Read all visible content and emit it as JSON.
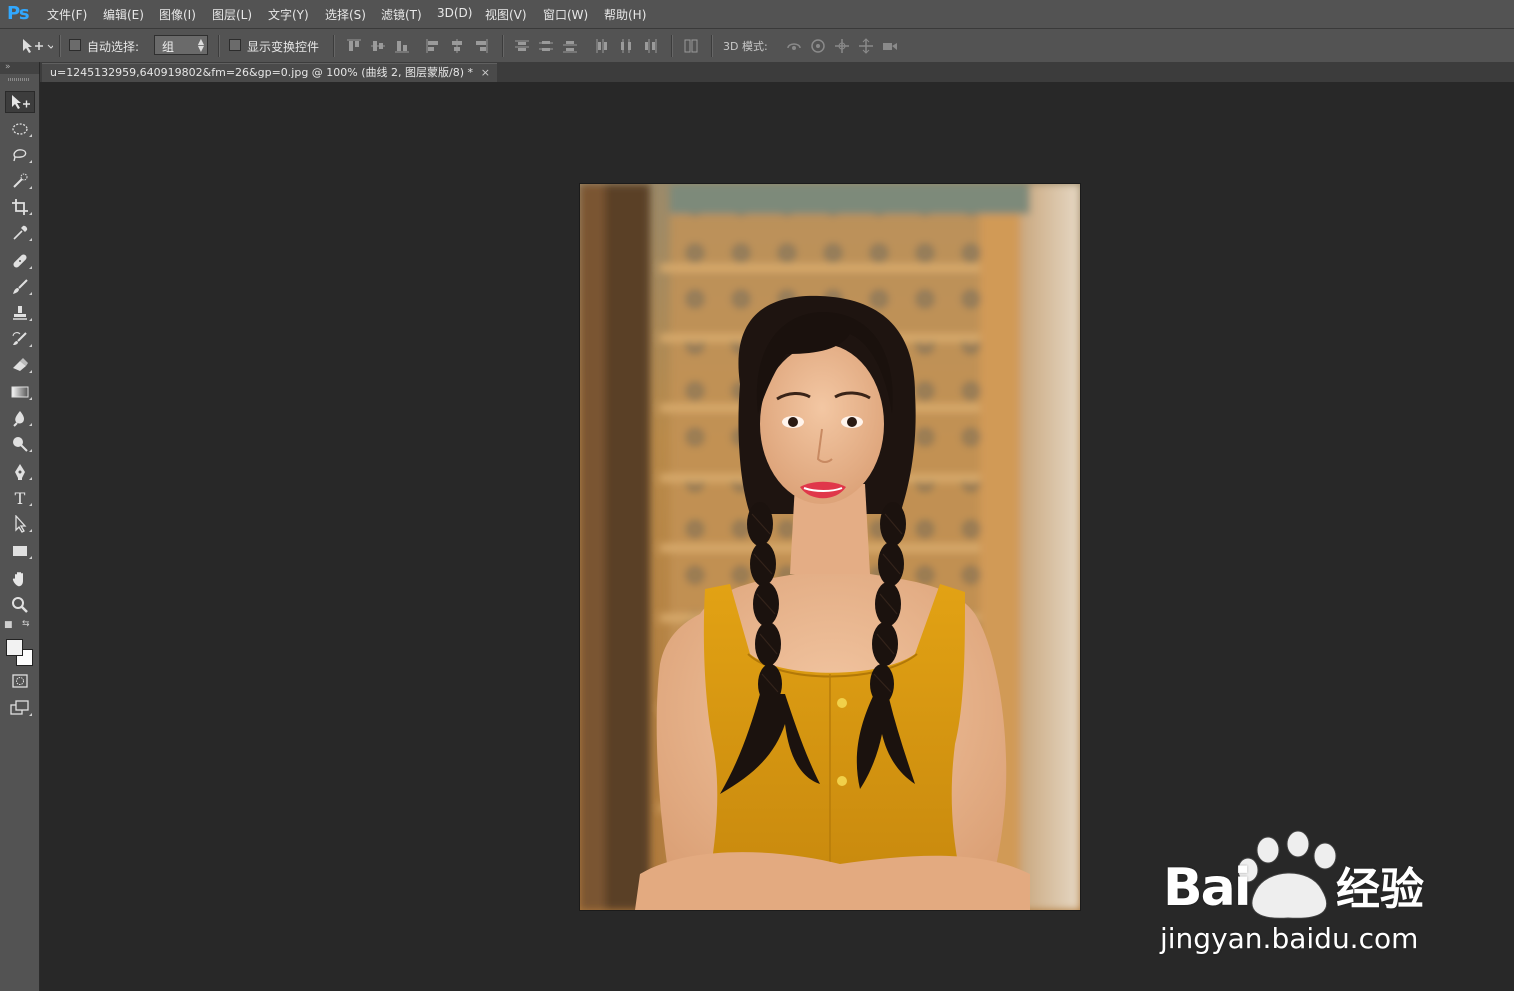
{
  "app": {
    "logo": "Ps"
  },
  "menu": {
    "items": [
      "文件(F)",
      "编辑(E)",
      "图像(I)",
      "图层(L)",
      "文字(Y)",
      "选择(S)",
      "滤镜(T)",
      "3D(D)",
      "视图(V)",
      "窗口(W)",
      "帮助(H)"
    ]
  },
  "options": {
    "auto_select_label": "自动选择:",
    "auto_select_value": "组",
    "show_transform_label": "显示变换控件",
    "mode_3d_label": "3D 模式:"
  },
  "document": {
    "tab_title": "u=1245132959,640919802&fm=26&gp=0.jpg @ 100% (曲线 2, 图层蒙版/8) *",
    "close_glyph": "×"
  },
  "toolbox": {
    "tools": [
      "move-tool",
      "elliptical-marquee-tool",
      "lasso-tool",
      "quick-selection-tool",
      "crop-tool",
      "eyedropper-tool",
      "healing-brush-tool",
      "brush-tool",
      "clone-stamp-tool",
      "history-brush-tool",
      "eraser-tool",
      "gradient-tool",
      "blur-tool",
      "dodge-tool",
      "pen-tool",
      "type-tool",
      "path-selection-tool",
      "rectangle-tool",
      "hand-tool",
      "zoom-tool",
      "quick-mask-mode",
      "screen-mode"
    ],
    "type_glyph": "T",
    "foreground_color": "#f2f2f2",
    "background_color": "#fdfdfd"
  },
  "watermark": {
    "brand": "Bai",
    "brand_suffix": "经验",
    "url": "jingyan.baidu.com"
  },
  "colors": {
    "workspace": "#282828",
    "panel": "#535353",
    "ps_blue": "#31a8ff",
    "dress_yellow": "#d99a12"
  }
}
